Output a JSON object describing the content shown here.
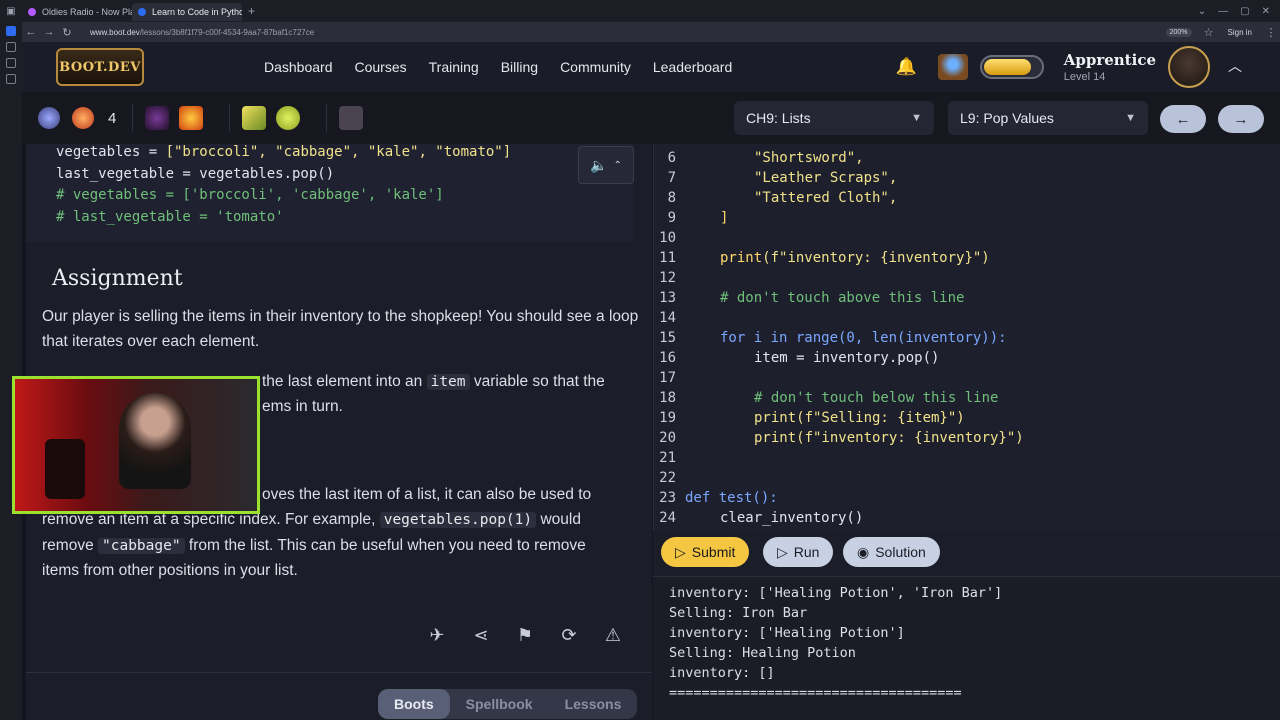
{
  "browser": {
    "tabs": [
      {
        "label": "Oldies Radio - Now Pla"
      },
      {
        "label": "Learn to Code in Python: F"
      }
    ],
    "url_host": "www.boot.dev",
    "url_path": "/lessons/3b8f1f79-c00f-4534-9aa7-87baf1c727ce",
    "zoom": "200%",
    "signin": "Sign in"
  },
  "header": {
    "logo": "BOOT.DEV",
    "nav": [
      "Dashboard",
      "Courses",
      "Training",
      "Billing",
      "Community",
      "Leaderboard"
    ],
    "rank_title": "Apprentice",
    "rank_level": "Level 14",
    "xp_fraction": 0.85
  },
  "toolbar": {
    "streak": "4",
    "chapter": "CH9: Lists",
    "lesson": "L9: Pop Values",
    "prev": "←",
    "next": "→"
  },
  "lesson": {
    "heading": "Assignment",
    "p1": "Our player is selling the items in their inventory to the shopkeep! You should see a loop that iterates over each element.",
    "p2a": "the last element into an",
    "p2_code": "item",
    "p2b": "variable so that the",
    "p2c": "ems in turn.",
    "p3a": "oves the last item of a list, it can also be used to",
    "p3b": "remove an item at a specific index. For example,",
    "p3_code1": "vegetables.pop(1)",
    "p3c": "would",
    "p3d": "remove",
    "p3_code2": "\"cabbage\"",
    "p3e": "from the list. This can be useful when you need to remove",
    "p3f": "items from other positions in your list.",
    "bottom_tabs": [
      "Boots",
      "Spellbook",
      "Lessons"
    ]
  },
  "snippet": [
    "vegetables = [\"broccoli\", \"cabbage\", \"kale\", \"tomato\"]",
    "last_vegetable = vegetables.pop()",
    "# vegetables = ['broccoli', 'cabbage', 'kale']",
    "# last_vegetable = 'tomato'"
  ],
  "editor": {
    "line_numbers": [
      "6",
      "7",
      "8",
      "9",
      "10",
      "11",
      "12",
      "13",
      "14",
      "15",
      "16",
      "17",
      "18",
      "19",
      "20",
      "21",
      "22",
      "23",
      "24"
    ],
    "l6": "\"Shortsword\",",
    "l7": "\"Leather Scraps\",",
    "l8": "\"Tattered Cloth\",",
    "l9": "]",
    "l11_fn": "print",
    "l11_rest": "(f\"inventory: {inventory}\")",
    "l13": "# don't touch above this line",
    "l15": "for i in range(0, len(inventory)):",
    "l16": "item = inventory.pop()",
    "l18": "# don't touch below this line",
    "l19": "print(f\"Selling: {item}\")",
    "l20": "print(f\"inventory: {inventory}\")",
    "l23": "def test():",
    "l24": "clear_inventory()"
  },
  "actions": {
    "submit": "Submit",
    "run": "Run",
    "solution": "Solution"
  },
  "console": [
    "inventory: ['Healing Potion', 'Iron Bar']",
    "Selling: Iron Bar",
    "inventory: ['Healing Potion']",
    "Selling: Healing Potion",
    "inventory: []",
    "===================================="
  ]
}
